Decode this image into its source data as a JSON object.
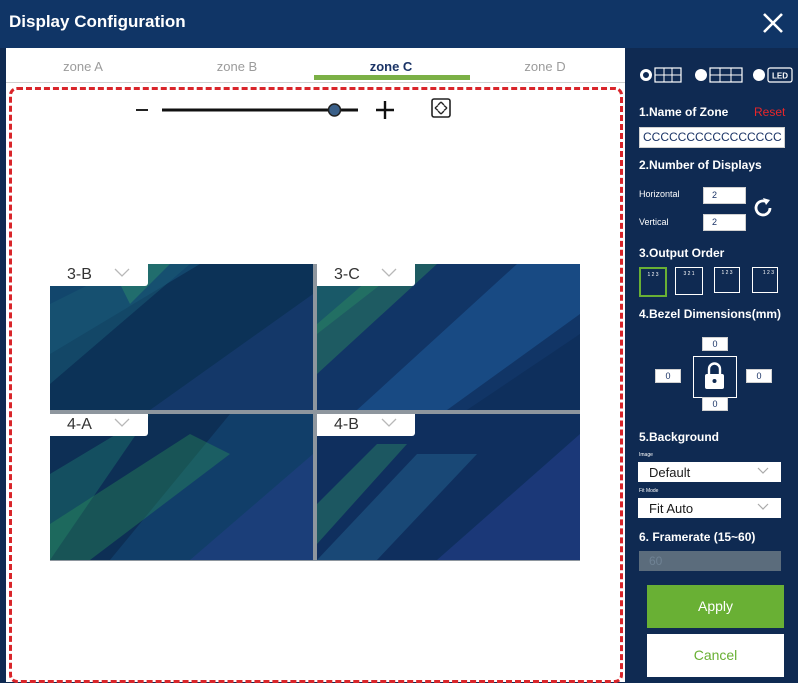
{
  "window": {
    "title": "Display Configuration"
  },
  "tabs": [
    {
      "label": "zone A"
    },
    {
      "label": "zone B"
    },
    {
      "label": "zone C",
      "active": true
    },
    {
      "label": "zone D"
    }
  ],
  "zoom": {
    "level": 0.88
  },
  "screens": [
    {
      "label": "3-B"
    },
    {
      "label": "3-C"
    },
    {
      "label": "4-A"
    },
    {
      "label": "4-B"
    }
  ],
  "panel": {
    "layout_options": [
      "grid-icon",
      "wide-grid-icon",
      "LED"
    ],
    "selected_layout": 0,
    "name_section": {
      "title": "1.Name of Zone",
      "reset": "Reset",
      "value": "CCCCCCCCCCCCCCCC"
    },
    "displays_section": {
      "title": "2.Number of Displays",
      "horizontal_label": "Horizontal",
      "horizontal": "2",
      "vertical_label": "Vertical",
      "vertical": "2"
    },
    "output_section": {
      "title": "3.Output Order",
      "orders": [
        "1 2 3",
        "3 2 1",
        "1 2 3",
        "1 2 3"
      ],
      "selected": 0
    },
    "bezel_section": {
      "title": "4.Bezel Dimensions(mm)",
      "top": "0",
      "left": "0",
      "right": "0",
      "bottom": "0"
    },
    "background_section": {
      "title": "5.Background",
      "image_label": "Image",
      "image_value": "Default",
      "fit_label": "Fit Mode",
      "fit_value": "Fit Auto"
    },
    "framerate_section": {
      "title": "6. Framerate (15~60)",
      "value": "60"
    },
    "apply": "Apply",
    "cancel": "Cancel"
  },
  "colors": {
    "accent": "#69b034",
    "header": "#103566",
    "panel": "#0f2a52",
    "dash": "#d9252a",
    "reset": "#e8262a"
  }
}
